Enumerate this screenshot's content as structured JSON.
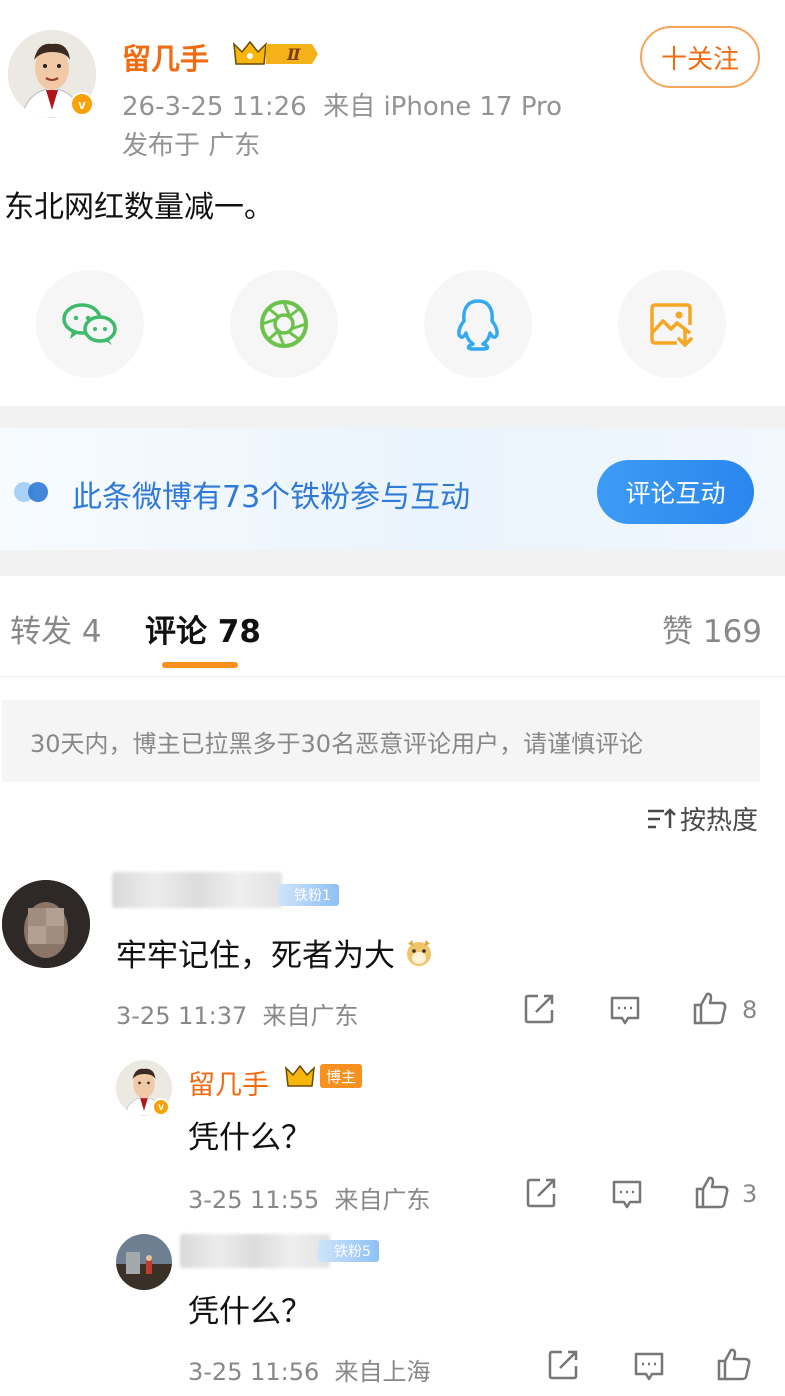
{
  "post": {
    "author": "留几手",
    "level_badge": "Ⅱ",
    "time_source": "26-3-25 11:26  来自 iPhone 17 Pro",
    "location": "发布于 广东",
    "follow_label": "十关注",
    "text": "东北网红数量减一。"
  },
  "share": {
    "items": [
      {
        "icon": "wechat-icon"
      },
      {
        "icon": "moments-icon"
      },
      {
        "icon": "qq-icon"
      },
      {
        "icon": "save-image-icon"
      }
    ]
  },
  "fans_bar": {
    "text": "此条微博有73个铁粉参与互动",
    "button": "评论互动"
  },
  "tabs": {
    "repost": "转发 4",
    "comments": "评论 78",
    "likes": "赞 169"
  },
  "notice": "30天内，博主已拉黑多于30名恶意评论用户，请谨慎评论",
  "sort_label": "按热度",
  "comments": [
    {
      "fan_badge": "铁粉1",
      "text": "牢牢记住，死者为大",
      "meta": "3-25 11:37  来自广东",
      "likes": "8"
    },
    {
      "author": "留几手",
      "role_badge": "博主",
      "text": "凭什么？",
      "meta": "3-25 11:55  来自广东",
      "likes": "3"
    },
    {
      "fan_badge": "铁粉5",
      "text": "凭什么？",
      "meta": "3-25 11:56  来自上海"
    }
  ],
  "colors": {
    "accent": "#f06b12",
    "link_blue": "#2f7ad6",
    "tab_underline": "#f7901e",
    "gray_text": "#888888"
  }
}
